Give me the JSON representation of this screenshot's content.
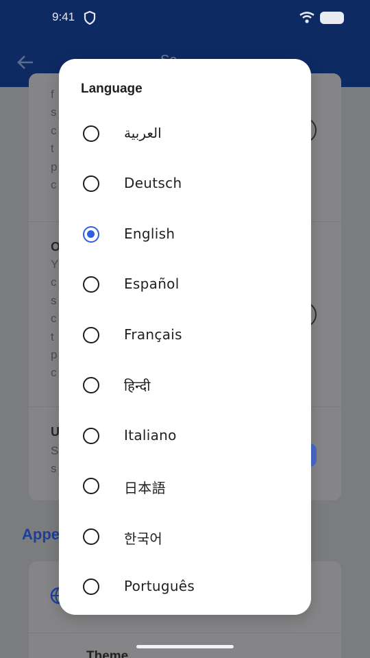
{
  "status_bar": {
    "time": "9:41"
  },
  "background": {
    "card1_fragments": [
      "f",
      "s",
      "c",
      "t",
      "p",
      "c"
    ],
    "card1b_head": "O",
    "card1b_fragments": [
      "Y",
      "c",
      "s",
      "c",
      "t",
      "p",
      "c"
    ],
    "card1c_head": "U",
    "card1c_fragments": [
      "S",
      "s"
    ],
    "section_heading": "Appe",
    "theme_label": "Theme"
  },
  "dialog": {
    "title": "Language",
    "selected": "English",
    "options": [
      {
        "label": "العربية",
        "selected": false
      },
      {
        "label": "Deutsch",
        "selected": false
      },
      {
        "label": "English",
        "selected": true
      },
      {
        "label": "Español",
        "selected": false
      },
      {
        "label": "Français",
        "selected": false
      },
      {
        "label": "हिन्दी",
        "selected": false
      },
      {
        "label": "Italiano",
        "selected": false
      },
      {
        "label": "日本語",
        "selected": false
      },
      {
        "label": "한국어",
        "selected": false
      },
      {
        "label": "Português",
        "selected": false
      }
    ]
  },
  "colors": {
    "app_bar": "#0e2a63",
    "accent": "#2f5fde",
    "scrim": "#7f7f81"
  }
}
